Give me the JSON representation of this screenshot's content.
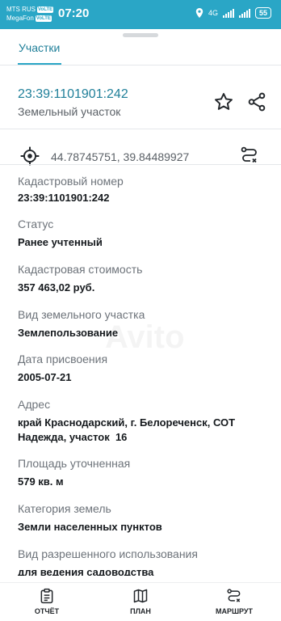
{
  "status_bar": {
    "carrier1": "MTS RUS",
    "carrier2": "MegaFon",
    "volte": "VoLTE",
    "time": "07:20",
    "network": "4G",
    "battery": "55"
  },
  "tabs": [
    {
      "label": "Участки",
      "active": true
    }
  ],
  "parcel": {
    "cadastral_id": "23:39:1101901:242",
    "type": "Земельный участок"
  },
  "coordinates": "44.78745751, 39.84489927",
  "watermark": "Avito",
  "details": [
    {
      "label": "Кадастровый номер",
      "value": "23:39:1101901:242"
    },
    {
      "label": "Статус",
      "value": "Ранее учтенный"
    },
    {
      "label": "Кадастровая стоимость",
      "value": "357 463,02 руб."
    },
    {
      "label": "Вид земельного участка",
      "value": "Землепользование"
    },
    {
      "label": "Дата присвоения",
      "value": "2005-07-21"
    },
    {
      "label": "Адрес",
      "value": "край Краснодарский, г. Белореченск, СОТ Надежда, участок  16"
    },
    {
      "label": "Площадь уточненная",
      "value": "579 кв. м"
    },
    {
      "label": "Категория земель",
      "value": "Земли населенных пунктов"
    },
    {
      "label": "Вид разрешенного использования",
      "value": "для ведения садоводства"
    }
  ],
  "bottom_nav": [
    {
      "label": "ОТЧЁТ",
      "icon": "report-icon"
    },
    {
      "label": "ПЛАН",
      "icon": "map-icon"
    },
    {
      "label": "МАРШРУТ",
      "icon": "route-icon"
    }
  ],
  "colors": {
    "accent": "#2aa6c6",
    "link": "#1f7f99",
    "label": "#6d737a"
  }
}
